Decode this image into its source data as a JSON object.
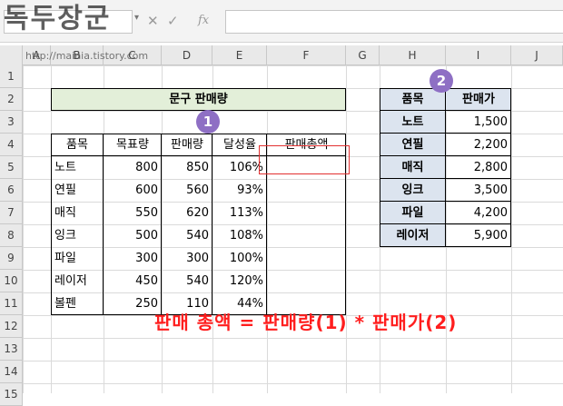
{
  "watermark": {
    "title": "독두장군",
    "url": "http://mainia.tistory.com"
  },
  "formula_bar": {
    "fx_label": "fx",
    "cancel_icon": "✕",
    "enter_icon": "✓",
    "dropdown_icon": "▾"
  },
  "columns": [
    "A",
    "B",
    "C",
    "D",
    "E",
    "F",
    "G",
    "H",
    "I",
    "J"
  ],
  "rows": [
    "1",
    "2",
    "3",
    "4",
    "5",
    "6",
    "7",
    "8",
    "9",
    "10",
    "11",
    "12",
    "13",
    "14",
    "15"
  ],
  "table1": {
    "title": "문구 판매량",
    "headers": [
      "품목",
      "목표량",
      "판매량",
      "달성율",
      "판매총액"
    ],
    "rows": [
      [
        "노트",
        "800",
        "850",
        "106%",
        ""
      ],
      [
        "연필",
        "600",
        "560",
        "93%",
        ""
      ],
      [
        "매직",
        "550",
        "620",
        "113%",
        ""
      ],
      [
        "잉크",
        "500",
        "540",
        "108%",
        ""
      ],
      [
        "파일",
        "300",
        "300",
        "100%",
        ""
      ],
      [
        "레이저",
        "450",
        "540",
        "120%",
        ""
      ],
      [
        "볼펜",
        "250",
        "110",
        "44%",
        ""
      ]
    ]
  },
  "table2": {
    "headers": [
      "품목",
      "판매가"
    ],
    "rows": [
      [
        "노트",
        "1,500"
      ],
      [
        "연필",
        "2,200"
      ],
      [
        "매직",
        "2,800"
      ],
      [
        "잉크",
        "3,500"
      ],
      [
        "파일",
        "4,200"
      ],
      [
        "레이저",
        "5,900"
      ]
    ]
  },
  "annotations": {
    "badge1": "1",
    "badge2": "2",
    "formula": "판매 총액 = 판매량(1) * 판매가(2)"
  },
  "colors": {
    "title_fill": "#e3efd9",
    "header_fill": "#dce4ef",
    "badge": "#8e6fc4",
    "highlight_red": "#e23030",
    "formula_red": "#ff1e1e"
  }
}
